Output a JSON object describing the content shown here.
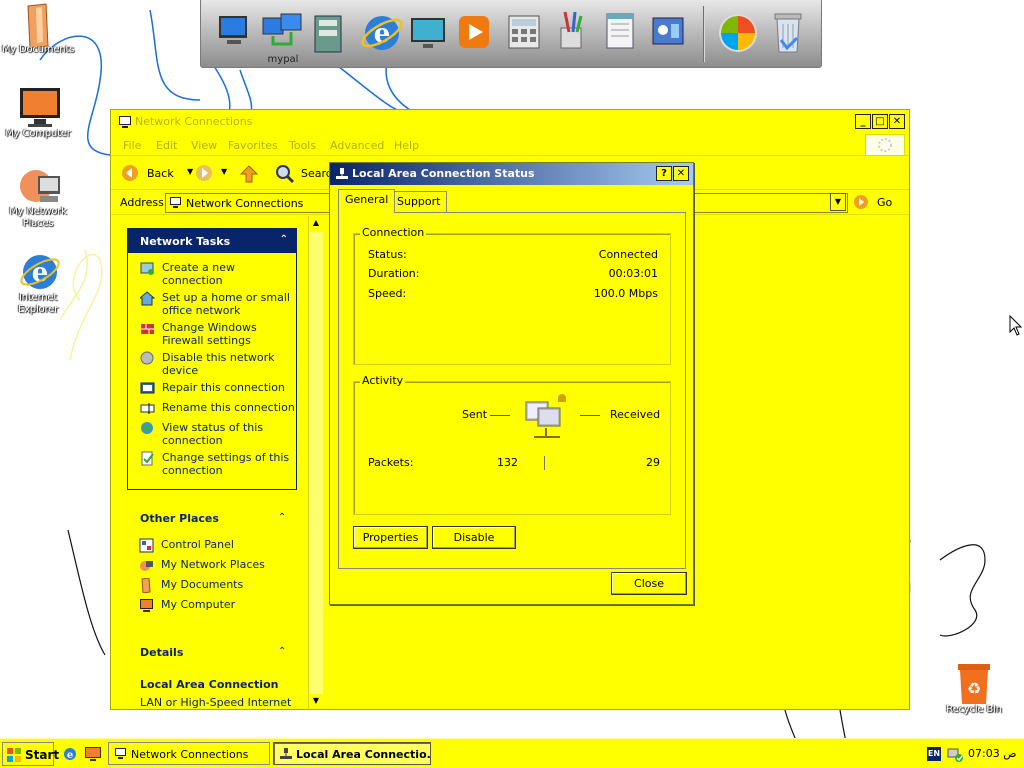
{
  "colors": {
    "window_bg": "#ffff00",
    "title_gradient_start": "#0a246a",
    "task_header": "#0a246a",
    "link": "#0a246a"
  },
  "desktop": {
    "icons": [
      {
        "label": "My Documents",
        "icon": "folder-icon"
      },
      {
        "label": "My Computer",
        "icon": "monitor-icon"
      },
      {
        "label": "My Network Places",
        "icon": "network-icon"
      },
      {
        "label": "Internet Explorer",
        "icon": "ie-icon"
      },
      {
        "label": "Recycle Bin",
        "icon": "recycle-bin-icon"
      }
    ]
  },
  "dock": {
    "items": [
      {
        "icon": "computer-icon",
        "label": ""
      },
      {
        "icon": "network-computers-icon",
        "label": "mypal"
      },
      {
        "icon": "folders-icon",
        "label": ""
      },
      {
        "icon": "ie-icon",
        "label": ""
      },
      {
        "icon": "monitor-icon",
        "label": ""
      },
      {
        "icon": "media-player-icon",
        "label": ""
      },
      {
        "icon": "calculator-icon",
        "label": ""
      },
      {
        "icon": "paint-icon",
        "label": ""
      },
      {
        "icon": "notepad-icon",
        "label": ""
      },
      {
        "icon": "control-panel-icon",
        "label": ""
      },
      {
        "icon": "windows-logo-icon",
        "label": ""
      },
      {
        "icon": "trash-icon",
        "label": ""
      }
    ]
  },
  "explorer": {
    "title": "Network Connections",
    "menu": [
      "File",
      "Edit",
      "View",
      "Favorites",
      "Tools",
      "Advanced",
      "Help"
    ],
    "toolbar": {
      "back": "Back",
      "search": "Searc"
    },
    "address": {
      "label": "Address",
      "value": "Network Connections",
      "go": "Go"
    },
    "network_tasks": {
      "title": "Network Tasks",
      "items": [
        {
          "line1": "Create a new",
          "line2": "connection",
          "icon": "new-connection-icon"
        },
        {
          "line1": "Set up a home or small",
          "line2": "office network",
          "icon": "home-network-icon"
        },
        {
          "line1": "Change Windows",
          "line2": "Firewall settings",
          "icon": "firewall-icon"
        },
        {
          "line1": "Disable this network",
          "line2": "device",
          "icon": "disable-icon"
        },
        {
          "line1": "Repair this connection",
          "line2": "",
          "icon": "repair-icon"
        },
        {
          "line1": "Rename this connection",
          "line2": "",
          "icon": "rename-icon"
        },
        {
          "line1": "View status of this",
          "line2": "connection",
          "icon": "globe-icon"
        },
        {
          "line1": "Change settings of this",
          "line2": "connection",
          "icon": "settings-icon"
        }
      ]
    },
    "other_places": {
      "title": "Other Places",
      "items": [
        {
          "label": "Control Panel",
          "icon": "control-panel-icon"
        },
        {
          "label": "My Network Places",
          "icon": "network-icon"
        },
        {
          "label": "My Documents",
          "icon": "folder-icon"
        },
        {
          "label": "My Computer",
          "icon": "monitor-icon"
        }
      ]
    },
    "details": {
      "title": "Details",
      "name": "Local Area Connection",
      "type": "LAN or High-Speed Internet"
    }
  },
  "dialog": {
    "title": "Local Area Connection Status",
    "help_btn": "?",
    "close_x": "✕",
    "tabs": [
      "General",
      "Support"
    ],
    "connection": {
      "title": "Connection",
      "status_label": "Status:",
      "status_value": "Connected",
      "duration_label": "Duration:",
      "duration_value": "00:03:01",
      "speed_label": "Speed:",
      "speed_value": "100.0 Mbps"
    },
    "activity": {
      "title": "Activity",
      "sent_label": "Sent",
      "received_label": "Received",
      "packets_label": "Packets:",
      "packets_sent": "132",
      "packets_received": "29"
    },
    "buttons": {
      "properties": "Properties",
      "disable": "Disable",
      "close": "Close"
    }
  },
  "taskbar": {
    "start": "Start",
    "tasks": [
      {
        "label": "Network Connections",
        "active": false
      },
      {
        "label": "Local Area Connectio...",
        "active": true
      }
    ],
    "lang": "EN",
    "clock": "07:03 ص"
  }
}
